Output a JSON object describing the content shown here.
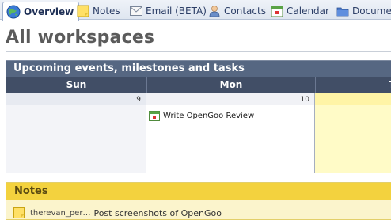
{
  "tabs": [
    {
      "label": "Overview",
      "icon": "globe-icon",
      "active": true
    },
    {
      "label": "Notes",
      "icon": "note-icon"
    },
    {
      "label": "Email (BETA)",
      "icon": "envelope-icon"
    },
    {
      "label": "Contacts",
      "icon": "person-icon"
    },
    {
      "label": "Calendar",
      "icon": "calendar-icon"
    },
    {
      "label": "Documents",
      "icon": "folder-icon"
    }
  ],
  "page": {
    "title": "All workspaces"
  },
  "calendar": {
    "title": "Upcoming events, milestones and tasks",
    "days": [
      {
        "name": "Sun",
        "number": "9"
      },
      {
        "name": "Mon",
        "number": "10"
      },
      {
        "name": "T",
        "number": ""
      }
    ],
    "event": {
      "title": "Write OpenGoo Review",
      "icon": "calendar-event-icon"
    }
  },
  "notes": {
    "title": "Notes",
    "items": [
      {
        "author": "therevan_per…",
        "title": "Post screenshots of OpenGoo"
      }
    ]
  },
  "colors": {
    "tab_text": "#2c3e66",
    "widget_header": "#566782",
    "day_header": "#414e66",
    "today_highlight": "#fffbc7",
    "notes_header": "#f3d23e",
    "notes_body": "#fbf4cc"
  }
}
